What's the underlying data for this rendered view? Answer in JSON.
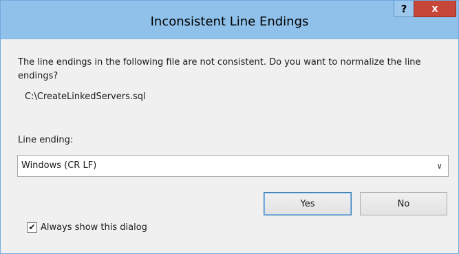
{
  "window": {
    "title": "Inconsistent Line Endings",
    "help_label": "?",
    "close_label": "x"
  },
  "dialog": {
    "message": "The line endings in the following file are not consistent. Do you want to normalize the line endings?",
    "file_path": "C:\\CreateLinkedServers.sql",
    "line_ending_label": "Line ending:",
    "line_ending_value": "Windows (CR LF)",
    "yes_label": "Yes",
    "no_label": "No",
    "always_show_label": "Always show this dialog",
    "always_show_checked": true,
    "checkmark": "✔",
    "dropdown_arrow": "∨"
  },
  "colors": {
    "titlebar": "#90c1ea",
    "close_button": "#c7463a",
    "background": "#f0f0f0"
  }
}
